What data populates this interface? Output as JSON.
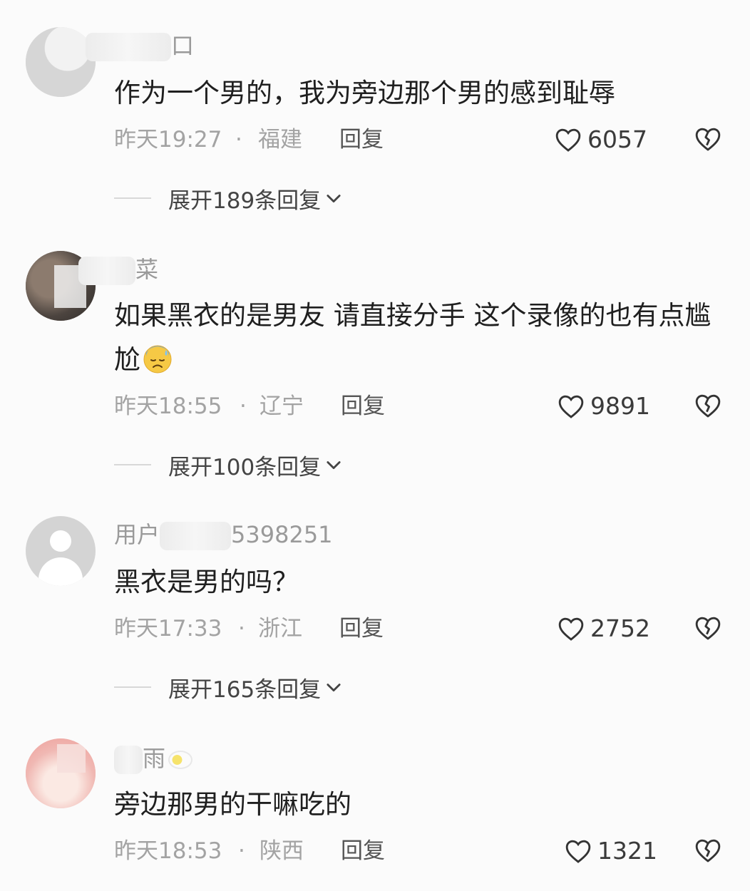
{
  "comments": [
    {
      "username_suffix": "口",
      "text": "作为一个男的，我为旁边那个男的感到耻辱",
      "time": "昨天19:27",
      "location": "福建",
      "reply_label": "回复",
      "likes": "6057",
      "expand_label": "展开189条回复"
    },
    {
      "username_suffix": "菜",
      "text": "如果黑衣的是男友 请直接分手 这个录像的也有点尴尬",
      "time": "昨天18:55",
      "location": "辽宁",
      "reply_label": "回复",
      "likes": "9891",
      "expand_label": "展开100条回复"
    },
    {
      "username_prefix": "用户",
      "username_suffix": "5398251",
      "text": "黑衣是男的吗？",
      "time": "昨天17:33",
      "location": "浙江",
      "reply_label": "回复",
      "likes": "2752",
      "expand_label": "展开165条回复"
    },
    {
      "username_suffix": "雨",
      "text": "旁边那男的干嘛吃的",
      "time": "昨天18:53",
      "location": "陕西",
      "reply_label": "回复",
      "likes": "1321"
    }
  ],
  "separator": "·",
  "icons": {
    "like": "heart-outline-icon",
    "dislike": "broken-heart-icon",
    "expand": "chevron-down-icon",
    "emoji": "anxious-sweat-emoji"
  }
}
